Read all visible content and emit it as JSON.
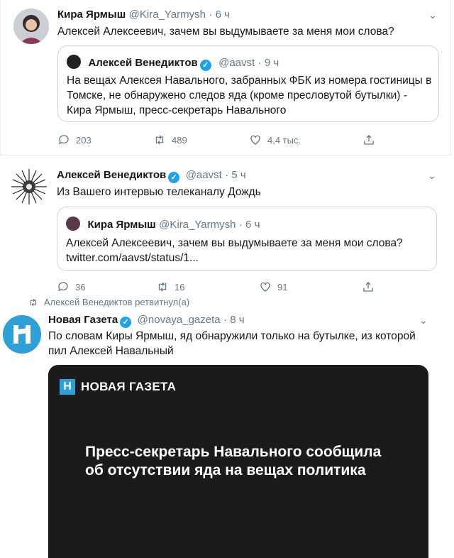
{
  "tweets": [
    {
      "name": "Кира Ярмыш",
      "handle": "@Kira_Yarmysh",
      "time": "· 6 ч",
      "text": "Алексей Алексеевич, зачем вы выдумываете за меня мои слова?",
      "quote": {
        "name": "Алексей Венедиктов",
        "handle": "@aavst",
        "time": "· 9 ч",
        "text": "На вещах Алексея Навального, забранных ФБК из номера гостиницы в Томске, не обнаружено следов яда (кроме пресловутой бутылки) - Кира Ярмыш, пресс-секретарь Навального"
      },
      "replies": "203",
      "retweets": "489",
      "likes": "4,4 тыс."
    },
    {
      "name": "Алексей Венедиктов",
      "handle": "@aavst",
      "time": "· 5 ч",
      "text": "Из Вашего интервью телеканалу Дождь",
      "quote": {
        "name": "Кира Ярмыш",
        "handle": "@Kira_Yarmysh",
        "time": "· 6 ч",
        "text": "Алексей Алексеевич, зачем вы выдумываете за меня мои слова?",
        "link": "twitter.com/aavst/status/1..."
      },
      "replies": "36",
      "retweets": "16",
      "likes": "91"
    },
    {
      "retweeted_by": "Алексей Венедиктов ретвитнул(а)",
      "name": "Новая Газета",
      "handle": "@novaya_gazeta",
      "time": "· 8 ч",
      "text": "По словам Киры Ярмыш, яд обнаружили только на бутылке, из которой пил Алексей Навальный",
      "card": {
        "logo_letter": "Н",
        "brand": "НОВАЯ ГАЗЕТА",
        "headline": "Пресс-секретарь Навального сообщила об отсутствии яда на вещах политика"
      }
    }
  ],
  "icons": {
    "reply": "reply-icon",
    "retweet": "retweet-icon",
    "like": "heart-icon",
    "share": "share-icon",
    "caret": "chevron-down-icon",
    "verified": "verified-badge-icon"
  },
  "colors": {
    "accent": "#1da1f2",
    "muted": "#657786",
    "card_bg": "#1b1b1b",
    "brand_blue": "#2f9fd8"
  }
}
